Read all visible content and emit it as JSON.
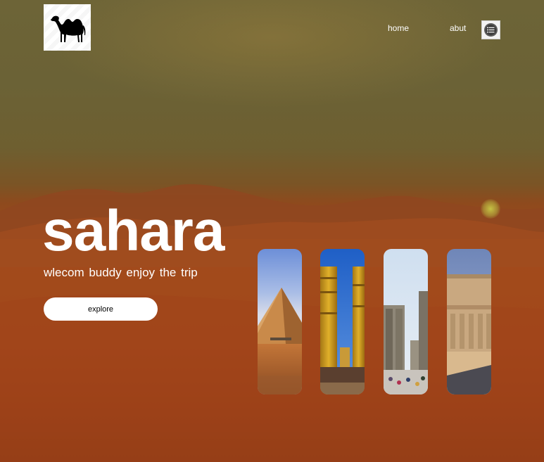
{
  "header": {
    "logo_icon": "camel-icon",
    "nav": [
      {
        "label": "home"
      },
      {
        "label": "abut"
      }
    ],
    "menu_icon": "list-menu-icon"
  },
  "hero": {
    "title": "sahara",
    "subtitle": "wlecom buddy enjoy the trip",
    "cta_label": "explore"
  },
  "gallery": [
    {
      "icon": "pyramid-photo"
    },
    {
      "icon": "temple-columns-photo"
    },
    {
      "icon": "luxor-temple-photo"
    },
    {
      "icon": "philae-temple-photo"
    }
  ],
  "colors": {
    "sky_top": "#6d6437",
    "sand": "#a24a1c",
    "text": "#ffffff",
    "button_bg": "#ffffff"
  }
}
